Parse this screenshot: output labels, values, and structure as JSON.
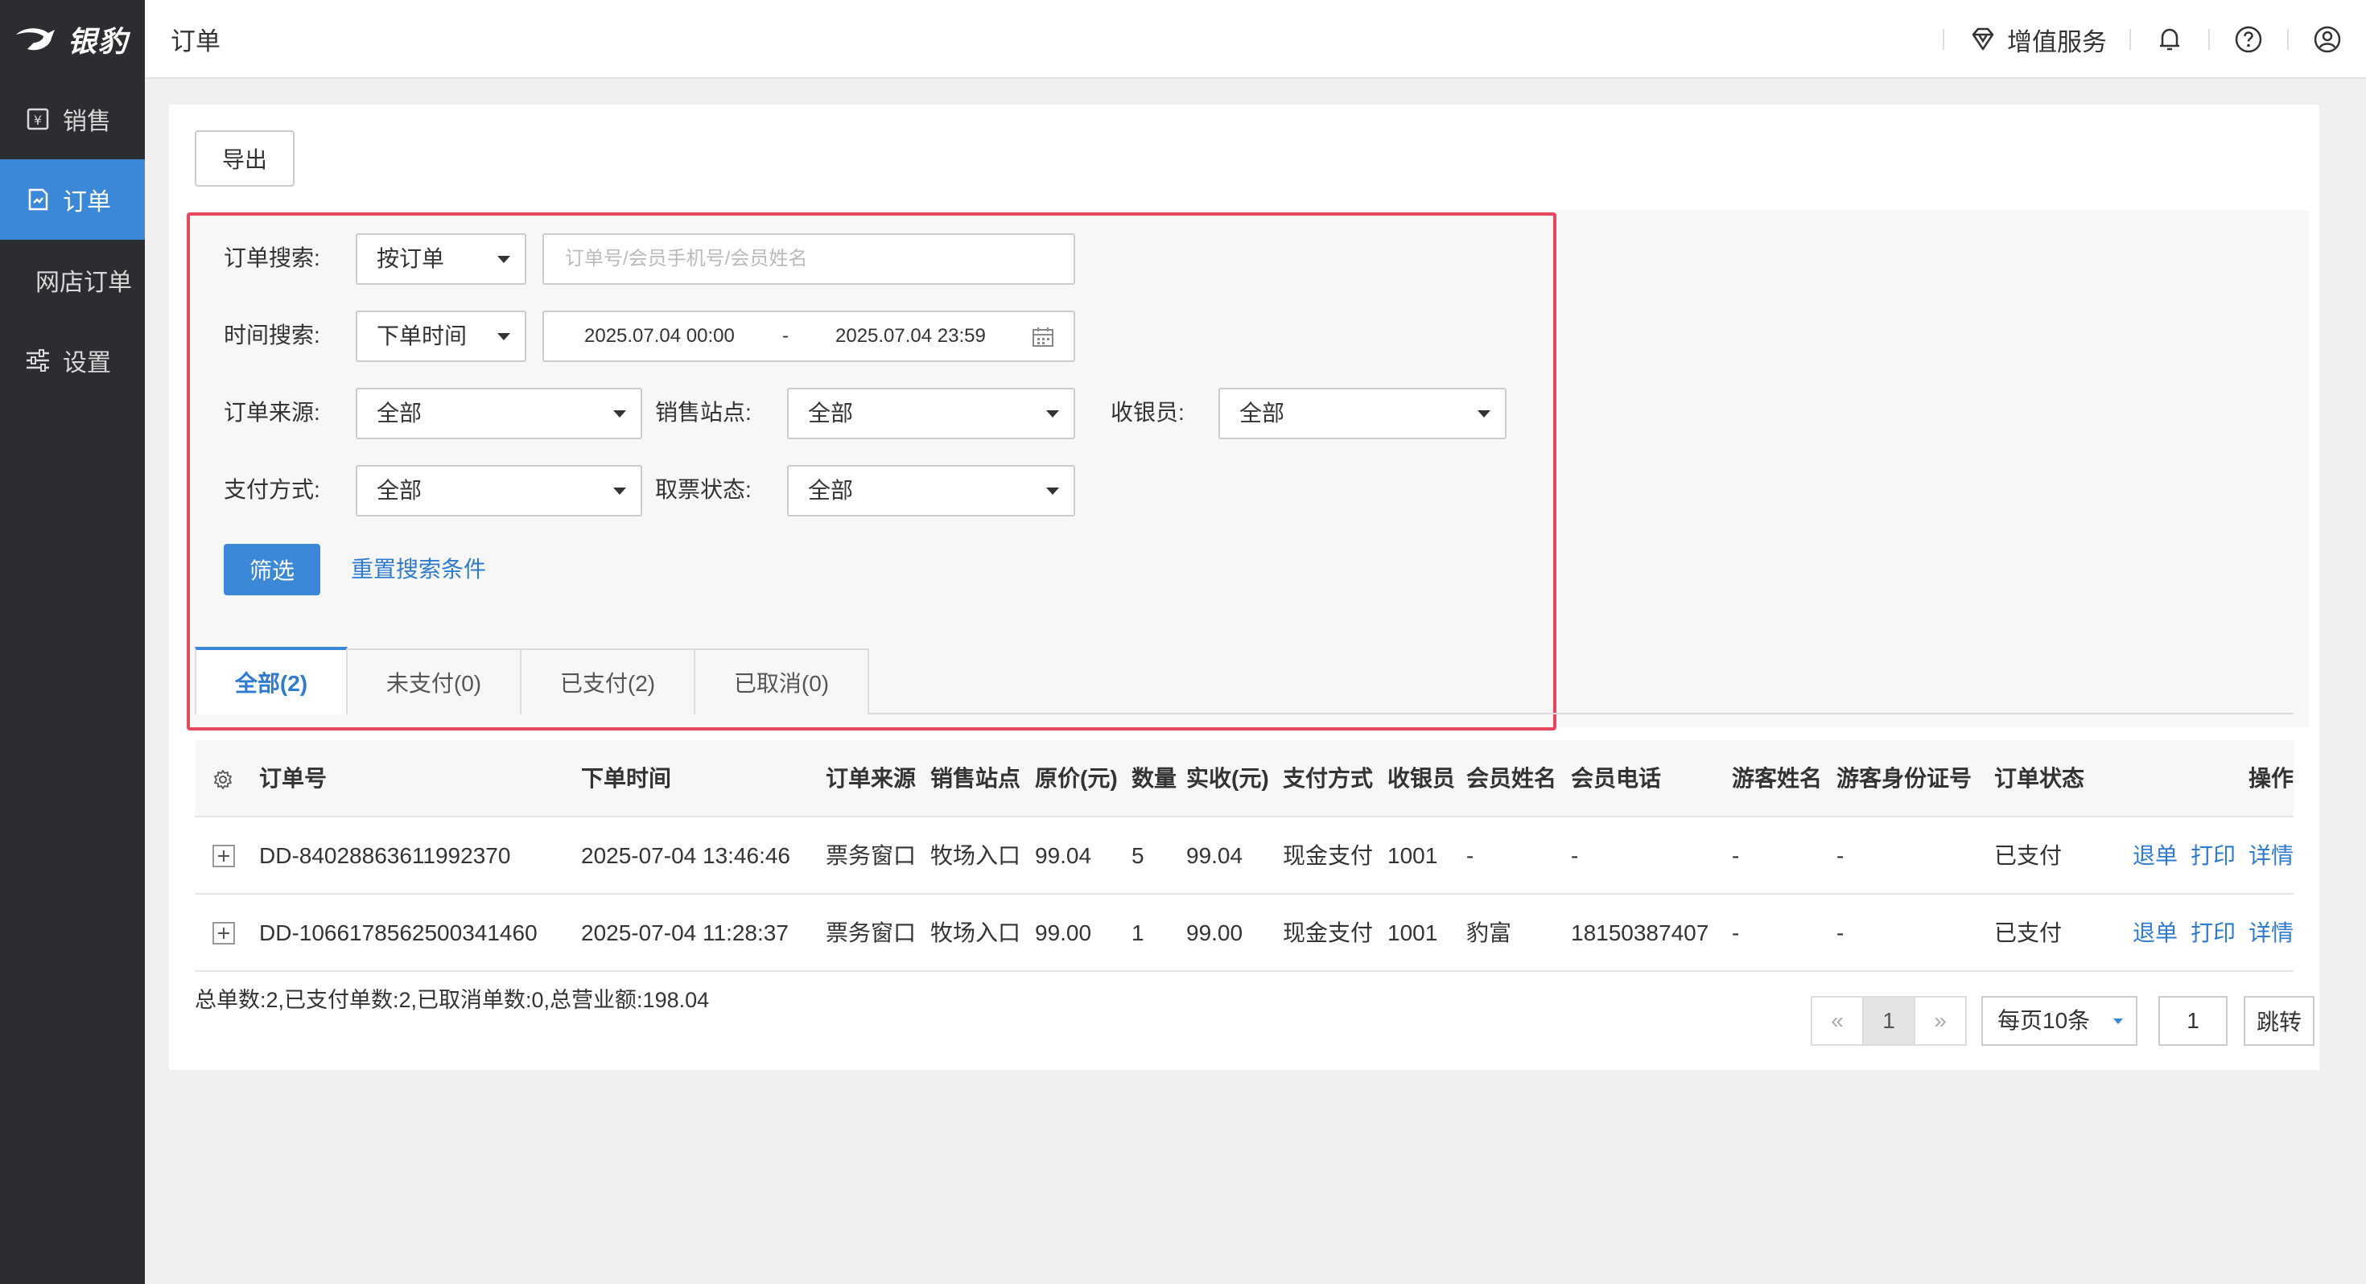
{
  "app": {
    "logo_text": "银豹"
  },
  "sidebar": {
    "items": [
      {
        "label": "销售",
        "icon": "money-icon"
      },
      {
        "label": "订单",
        "icon": "order-icon"
      },
      {
        "label": "网店订单"
      },
      {
        "label": "设置",
        "icon": "sliders-icon"
      }
    ]
  },
  "header": {
    "title": "订单",
    "value_service": "增值服务"
  },
  "toolbar": {
    "export_label": "导出"
  },
  "filters": {
    "order_search_label": "订单搜索:",
    "order_search_type": "按订单",
    "order_search_placeholder": "订单号/会员手机号/会员姓名",
    "time_search_label": "时间搜索:",
    "time_search_type": "下单时间",
    "date_start": "2025.07.04 00:00",
    "date_sep": "-",
    "date_end": "2025.07.04 23:59",
    "source_label": "订单来源:",
    "source_value": "全部",
    "site_label": "销售站点:",
    "site_value": "全部",
    "cashier_label": "收银员:",
    "cashier_value": "全部",
    "payment_label": "支付方式:",
    "payment_value": "全部",
    "ticket_status_label": "取票状态:",
    "ticket_status_value": "全部",
    "filter_button": "筛选",
    "reset_link": "重置搜索条件"
  },
  "tabs": [
    {
      "label": "全部(2)",
      "active": true
    },
    {
      "label": "未支付(0)"
    },
    {
      "label": "已支付(2)"
    },
    {
      "label": "已取消(0)"
    }
  ],
  "table": {
    "headers": [
      "订单号",
      "下单时间",
      "订单来源",
      "销售站点",
      "原价(元)",
      "数量",
      "实收(元)",
      "支付方式",
      "收银员",
      "会员姓名",
      "会员电话",
      "游客姓名",
      "游客身份证号",
      "订单状态",
      "操作"
    ],
    "rows": [
      {
        "order_no": "DD-84028863611992370",
        "time": "2025-07-04 13:46:46",
        "source": "票务窗口",
        "site": "牧场入口",
        "price": "99.04",
        "qty": "5",
        "received": "99.04",
        "payment": "现金支付",
        "cashier": "1001",
        "member_name": "-",
        "member_phone": "-",
        "guest_name": "-",
        "guest_id": "-",
        "status": "已支付",
        "actions": [
          "退单",
          "打印",
          "详情"
        ]
      },
      {
        "order_no": "DD-1066178562500341460",
        "time": "2025-07-04 11:28:37",
        "source": "票务窗口",
        "site": "牧场入口",
        "price": "99.00",
        "qty": "1",
        "received": "99.00",
        "payment": "现金支付",
        "cashier": "1001",
        "member_name": "豹富",
        "member_phone": "18150387407",
        "guest_name": "-",
        "guest_id": "-",
        "status": "已支付",
        "actions": [
          "退单",
          "打印",
          "详情"
        ]
      }
    ]
  },
  "summary": "总单数:2,已支付单数:2,已取消单数:0,总营业额:198.04",
  "pagination": {
    "prev": "«",
    "current_page": "1",
    "next": "»",
    "page_size": "每页10条",
    "jump_value": "1",
    "jump_label": "跳转"
  },
  "colors": {
    "accent": "#3b87d8",
    "sidebar_bg": "#2b2d30",
    "highlight_border": "#e8485e",
    "link": "#2f7bd0"
  }
}
